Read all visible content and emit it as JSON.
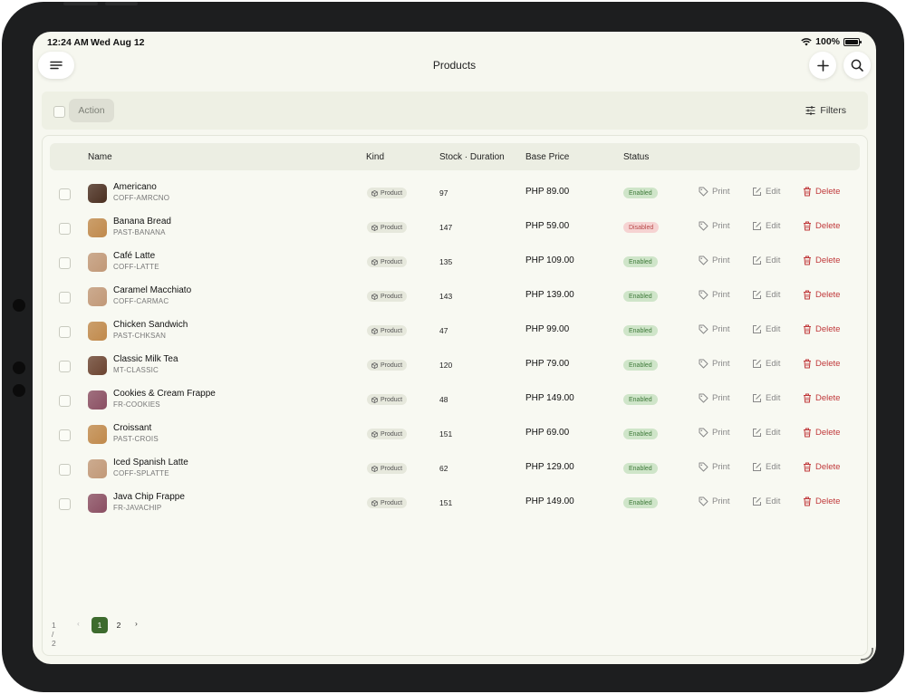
{
  "status_bar": {
    "time": "12:24 AM",
    "date": "Wed Aug 12",
    "battery": "100%"
  },
  "header": {
    "title": "Products"
  },
  "toolbar": {
    "action_label": "Action",
    "filters_label": "Filters"
  },
  "table": {
    "columns": {
      "name": "Name",
      "kind": "Kind",
      "stock": "Stock · Duration",
      "price": "Base Price",
      "status": "Status"
    },
    "action_labels": {
      "print": "Print",
      "edit": "Edit",
      "delete": "Delete"
    },
    "rows": [
      {
        "name": "Americano",
        "sku": "COFF-AMRCNO",
        "kind": "Product",
        "stock": "97",
        "price": "PHP 89.00",
        "status": "Enabled",
        "color": "#4a2e20"
      },
      {
        "name": "Banana Bread",
        "sku": "PAST-BANANA",
        "kind": "Product",
        "stock": "147",
        "price": "PHP 59.00",
        "status": "Disabled",
        "color": "#c0894b"
      },
      {
        "name": "Café Latte",
        "sku": "COFF-LATTE",
        "kind": "Product",
        "stock": "135",
        "price": "PHP 109.00",
        "status": "Enabled",
        "color": "#c19877"
      },
      {
        "name": "Caramel Macchiato",
        "sku": "COFF-CARMAC",
        "kind": "Product",
        "stock": "143",
        "price": "PHP 139.00",
        "status": "Enabled",
        "color": "#c19877"
      },
      {
        "name": "Chicken Sandwich",
        "sku": "PAST-CHKSAN",
        "kind": "Product",
        "stock": "47",
        "price": "PHP 99.00",
        "status": "Enabled",
        "color": "#c0894b"
      },
      {
        "name": "Classic Milk Tea",
        "sku": "MT-CLASSIC",
        "kind": "Product",
        "stock": "120",
        "price": "PHP 79.00",
        "status": "Enabled",
        "color": "#6b4330"
      },
      {
        "name": "Cookies & Cream Frappe",
        "sku": "FR-COOKIES",
        "kind": "Product",
        "stock": "48",
        "price": "PHP 149.00",
        "status": "Enabled",
        "color": "#8a4e62"
      },
      {
        "name": "Croissant",
        "sku": "PAST-CROIS",
        "kind": "Product",
        "stock": "151",
        "price": "PHP 69.00",
        "status": "Enabled",
        "color": "#c0894b"
      },
      {
        "name": "Iced Spanish Latte",
        "sku": "COFF-SPLATTE",
        "kind": "Product",
        "stock": "62",
        "price": "PHP 129.00",
        "status": "Enabled",
        "color": "#c19877"
      },
      {
        "name": "Java Chip Frappe",
        "sku": "FR-JAVACHIP",
        "kind": "Product",
        "stock": "151",
        "price": "PHP 149.00",
        "status": "Enabled",
        "color": "#8a4e62"
      }
    ]
  },
  "pagination": {
    "count": "1 / 2",
    "prev": "‹",
    "pages": [
      "1",
      "2"
    ],
    "next": "›"
  },
  "colors": {
    "accent": "#3d6b2e",
    "enabled_bg": "#cfe5c9",
    "enabled_text": "#3f7a3a",
    "disabled_bg": "#f6d3d2",
    "disabled_text": "#b84a4a",
    "delete": "#c0393b"
  }
}
